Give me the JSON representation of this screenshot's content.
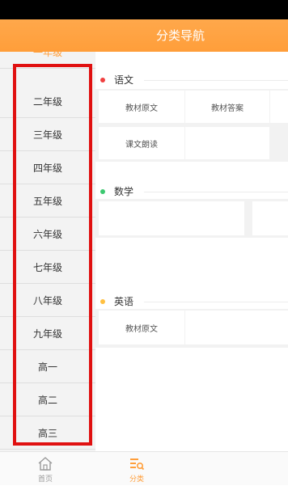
{
  "header": {
    "title": "分类导航"
  },
  "sidebar": {
    "items": [
      {
        "label": "一年级"
      },
      {
        "label": "二年级"
      },
      {
        "label": "三年级"
      },
      {
        "label": "四年级"
      },
      {
        "label": "五年级"
      },
      {
        "label": "六年级"
      },
      {
        "label": "七年级"
      },
      {
        "label": "八年级"
      },
      {
        "label": "九年级"
      },
      {
        "label": "高一"
      },
      {
        "label": "高二"
      },
      {
        "label": "高三"
      }
    ],
    "active_index": 0
  },
  "sections": [
    {
      "title": "语文",
      "dot_color": "#f04040",
      "items": [
        "教材原文",
        "教材答案",
        "课文朗读"
      ]
    },
    {
      "title": "数学",
      "dot_color": "#3cc870",
      "items": [
        "",
        ""
      ]
    },
    {
      "title": "英语",
      "dot_color": "#ffc040",
      "items": [
        "教材原文"
      ]
    }
  ],
  "tabbar": {
    "tabs": [
      {
        "label": "首页",
        "icon": "home-icon",
        "active": false
      },
      {
        "label": "分类",
        "icon": "category-icon",
        "active": true
      }
    ]
  },
  "colors": {
    "accent": "#ff9e3a",
    "highlight_frame": "#e01010"
  }
}
